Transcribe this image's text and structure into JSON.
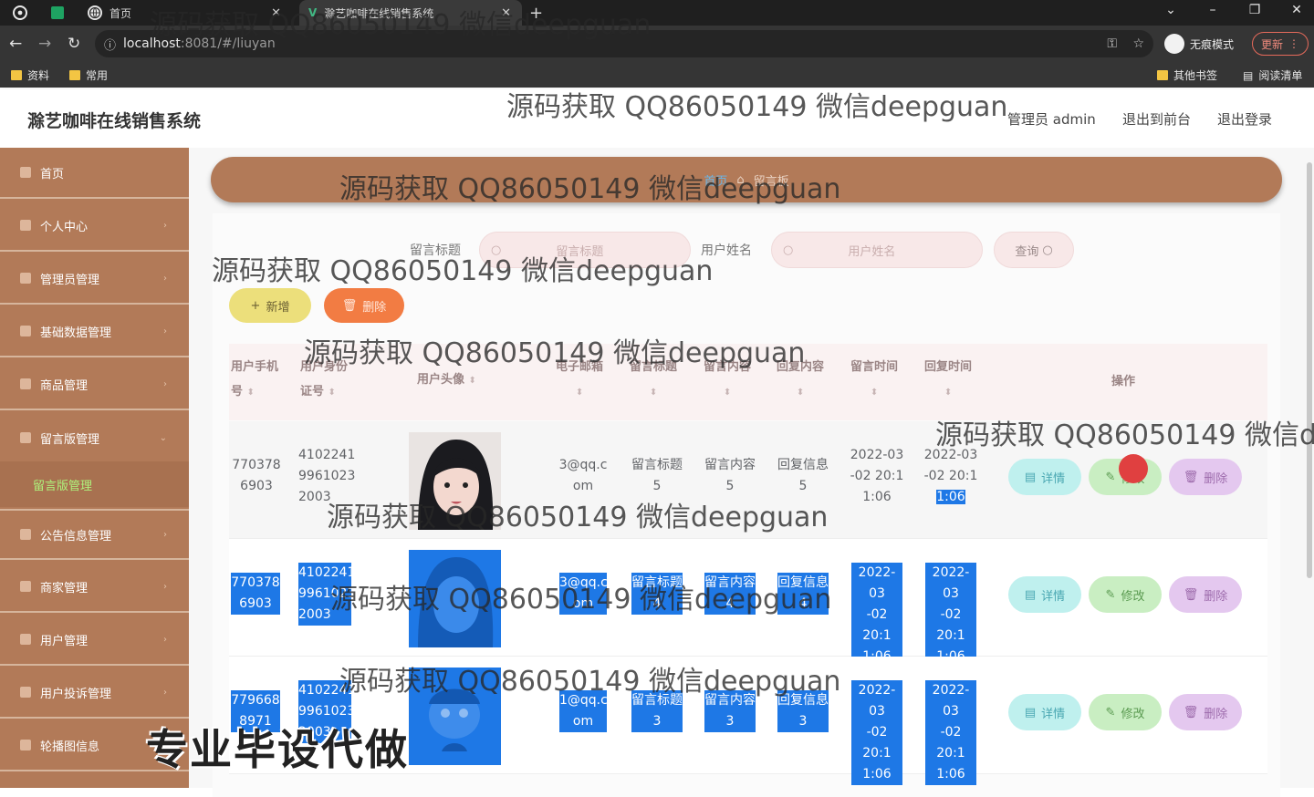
{
  "browser": {
    "tabs": [
      {
        "label": "首页"
      },
      {
        "label": "滁艺咖啡在线销售系统"
      }
    ],
    "new_tab": "+",
    "url_host": "localhost",
    "url_path": ":8081/#/liuyan",
    "incognito_label": "无痕模式",
    "update_label": "更新",
    "bookmarks": [
      "资料",
      "常用"
    ],
    "other_bookmarks": "其他书签",
    "reading_list": "阅读清单"
  },
  "header": {
    "title": "滁艺咖啡在线销售系统",
    "admin": "管理员 admin",
    "to_front": "退出到前台",
    "logout": "退出登录"
  },
  "sidebar": {
    "items": [
      {
        "label": "首页"
      },
      {
        "label": "个人中心"
      },
      {
        "label": "管理员管理"
      },
      {
        "label": "基础数据管理"
      },
      {
        "label": "商品管理"
      },
      {
        "label": "留言版管理"
      },
      {
        "label": "公告信息管理"
      },
      {
        "label": "商家管理"
      },
      {
        "label": "用户管理"
      },
      {
        "label": "用户投诉管理"
      },
      {
        "label": "轮播图信息"
      }
    ],
    "sub_active": "留言版管理"
  },
  "breadcrumb": {
    "home": "首页",
    "current": "留言板"
  },
  "search": {
    "title_label": "留言标题",
    "title_placeholder": "留言标题",
    "user_label": "用户姓名",
    "user_placeholder": "用户姓名",
    "query_label": "查询"
  },
  "actions": {
    "add": "新增",
    "delete": "删除"
  },
  "table": {
    "headers": {
      "phone_a": "用户手机",
      "phone_b": "号",
      "idcard_a": "用户身份",
      "idcard_b": "证号",
      "avatar": "用户头像",
      "email": "电子邮箱",
      "title": "留言标题",
      "content": "留言内容",
      "reply": "回复内容",
      "time": "留言时间",
      "reply_time": "回复时间",
      "ops": "操作"
    },
    "rows": [
      {
        "phone_a": "770378",
        "phone_b": "6903",
        "id_a": "4102241",
        "id_b": "9961023",
        "id_c": "2003",
        "email_a": "3@qq.c",
        "email_b": "om",
        "title_a": "留言标题",
        "title_b": "5",
        "content_a": "留言内容",
        "content_b": "5",
        "reply_a": "回复信息",
        "reply_b": "5",
        "time_a": "2022-03",
        "time_b": "-02 20:1",
        "time_c": "1:06",
        "rtime_a": "2022-03",
        "rtime_b": "-02 20:1",
        "rtime_c": "1:06"
      },
      {
        "phone_a": "770378",
        "phone_b": "6903",
        "id_a": "4102241",
        "id_b": "9961023",
        "id_c": "2003",
        "email_a": "3@qq.c",
        "email_b": "om",
        "title_a": "留言标题",
        "title_b": "4",
        "content_a": "留言内容",
        "content_b": "4",
        "reply_a": "回复信息",
        "reply_b": "4",
        "time_a": "2022-03",
        "time_b": "-02 20:1",
        "time_c": "1:06",
        "rtime_a": "2022-03",
        "rtime_b": "-02 20:1",
        "rtime_c": "1:06"
      },
      {
        "phone_a": "779668",
        "phone_b": "8971",
        "id_a": "4102241",
        "id_b": "9961023",
        "id_c": "2003",
        "email_a": "1@qq.c",
        "email_b": "om",
        "title_a": "留言标题",
        "title_b": "3",
        "content_a": "留言内容",
        "content_b": "3",
        "reply_a": "回复信息",
        "reply_b": "3",
        "time_a": "2022-03",
        "time_b": "-02 20:1",
        "time_c": "1:06",
        "rtime_a": "2022-03",
        "rtime_b": "-02 20:1",
        "rtime_c": "1:06"
      }
    ],
    "op_detail": "详情",
    "op_edit": "修改",
    "op_delete": "删除"
  },
  "watermark": "源码获取 QQ86050149 微信deepguan",
  "bigmark": "专业毕设代做",
  "colors": {
    "sidebar": "#b27a58",
    "active_sub": "#aef27c",
    "selection": "#1e78e6"
  }
}
